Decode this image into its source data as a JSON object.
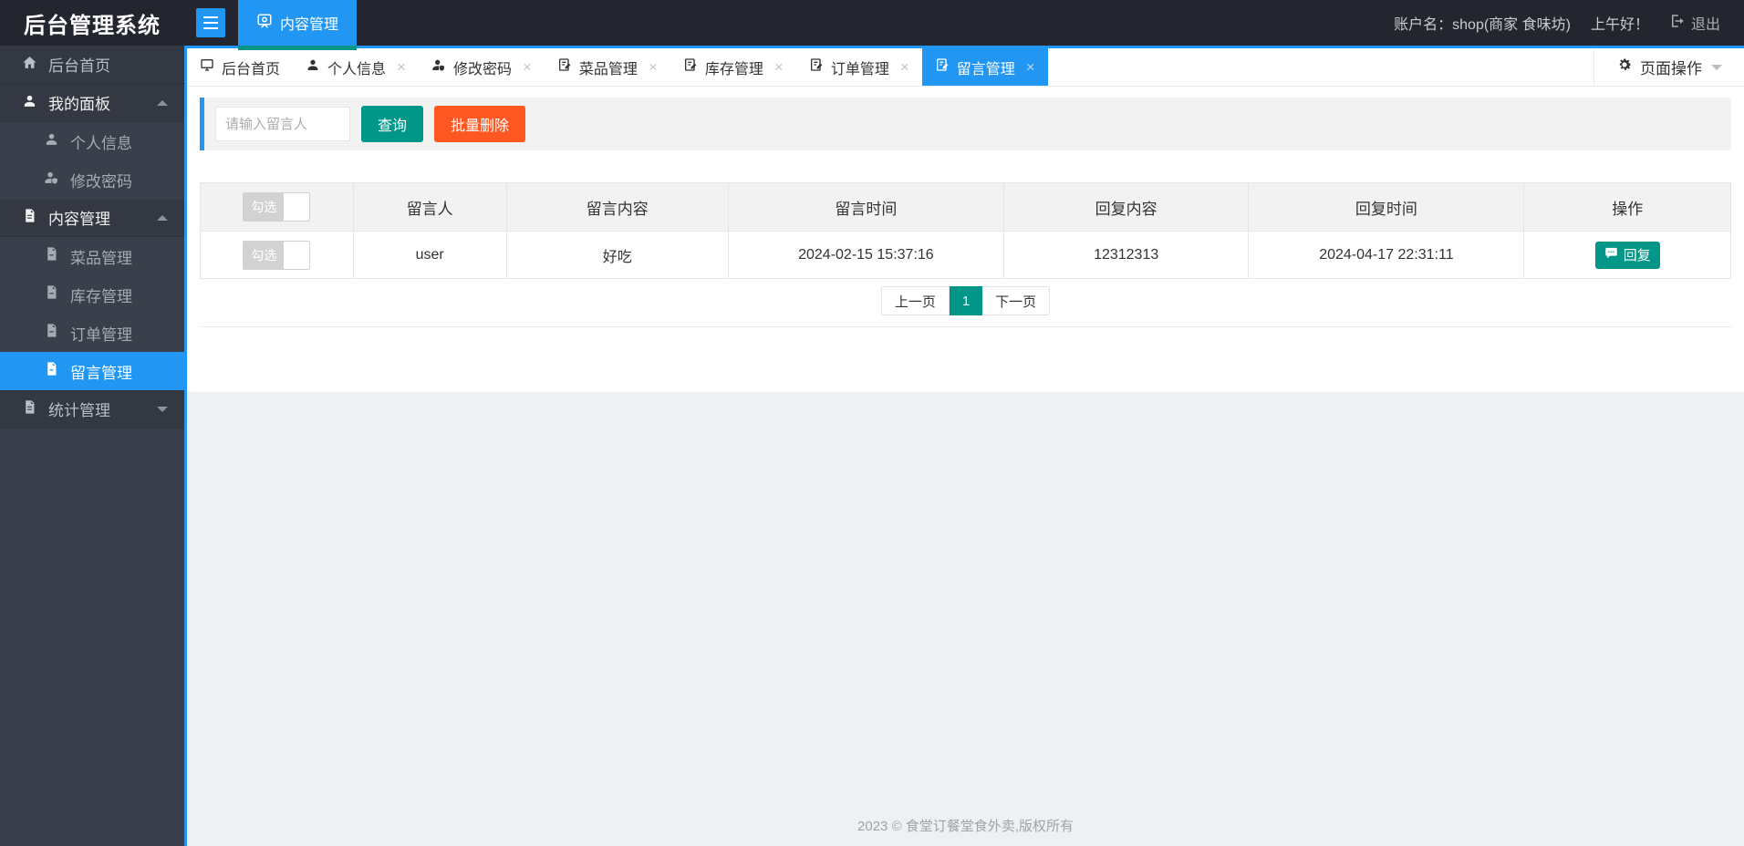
{
  "app": {
    "title": "后台管理系统"
  },
  "header": {
    "nav_tab": "内容管理",
    "account_label": "账户名：shop(商家 食味坊)",
    "greeting": "上午好！",
    "logout_label": "退出"
  },
  "sidebar": {
    "items": [
      {
        "label": "后台首页",
        "type": "parent"
      },
      {
        "label": "我的面板",
        "type": "parent",
        "expanded": true
      },
      {
        "label": "个人信息",
        "type": "child"
      },
      {
        "label": "修改密码",
        "type": "child"
      },
      {
        "label": "内容管理",
        "type": "parent",
        "expanded": true
      },
      {
        "label": "菜品管理",
        "type": "child"
      },
      {
        "label": "库存管理",
        "type": "child"
      },
      {
        "label": "订单管理",
        "type": "child"
      },
      {
        "label": "留言管理",
        "type": "child",
        "active": true
      },
      {
        "label": "统计管理",
        "type": "parent",
        "expanded": false
      }
    ]
  },
  "tabbar": {
    "tabs": [
      {
        "label": "后台首页",
        "closable": false
      },
      {
        "label": "个人信息",
        "closable": true
      },
      {
        "label": "修改密码",
        "closable": true
      },
      {
        "label": "菜品管理",
        "closable": true
      },
      {
        "label": "库存管理",
        "closable": true
      },
      {
        "label": "订单管理",
        "closable": true
      },
      {
        "label": "留言管理",
        "closable": true,
        "active": true
      }
    ],
    "page_ops_label": "页面操作"
  },
  "toolbar": {
    "search_placeholder": "请输入留言人",
    "query_button": "查询",
    "batch_delete_button": "批量删除"
  },
  "table": {
    "checkbox_label": "勾选",
    "columns": [
      "留言人",
      "留言内容",
      "留言时间",
      "回复内容",
      "回复时间",
      "操作"
    ],
    "rows": [
      {
        "user": "user",
        "content": "好吃",
        "time": "2024-02-15 15:37:16",
        "reply_content": "12312313",
        "reply_time": "2024-04-17 22:31:11",
        "action_label": "回复"
      }
    ]
  },
  "pagination": {
    "prev": "上一页",
    "current": "1",
    "next": "下一页"
  },
  "footer": {
    "copyright": "2023 © 食堂订餐堂食外卖,版权所有"
  },
  "colors": {
    "accent_blue": "#2196F3",
    "teal": "#009688",
    "danger_orange": "#FF5722",
    "header_dark": "#23262E",
    "sidebar_dark": "#3A3F4B",
    "body_gray": "#EFF0F4",
    "panel_gray": "#F2F2F2",
    "border_gray": "#E6E6E6"
  }
}
